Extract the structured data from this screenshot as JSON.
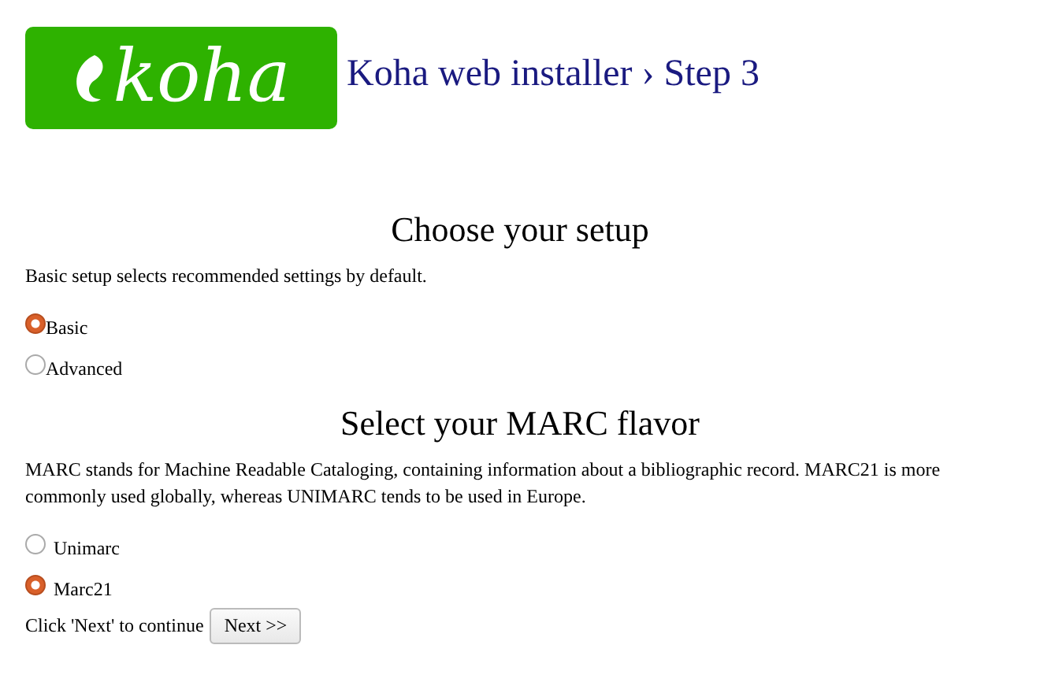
{
  "header": {
    "logo_text": "koha",
    "title": "Koha web installer › Step 3"
  },
  "setup": {
    "heading": "Choose your setup",
    "description": "Basic setup selects recommended settings by default.",
    "options": [
      {
        "label": "Basic",
        "selected": true
      },
      {
        "label": "Advanced",
        "selected": false
      }
    ]
  },
  "marc": {
    "heading": "Select your MARC flavor",
    "description": "MARC stands for Machine Readable Cataloging, containing information about a bibliographic record. MARC21 is more commonly used globally, whereas UNIMARC tends to be used in Europe.",
    "options": [
      {
        "label": "Unimarc",
        "selected": false
      },
      {
        "label": "Marc21",
        "selected": true
      }
    ]
  },
  "footer": {
    "prompt": "Click 'Next' to continue",
    "button": "Next >>"
  }
}
